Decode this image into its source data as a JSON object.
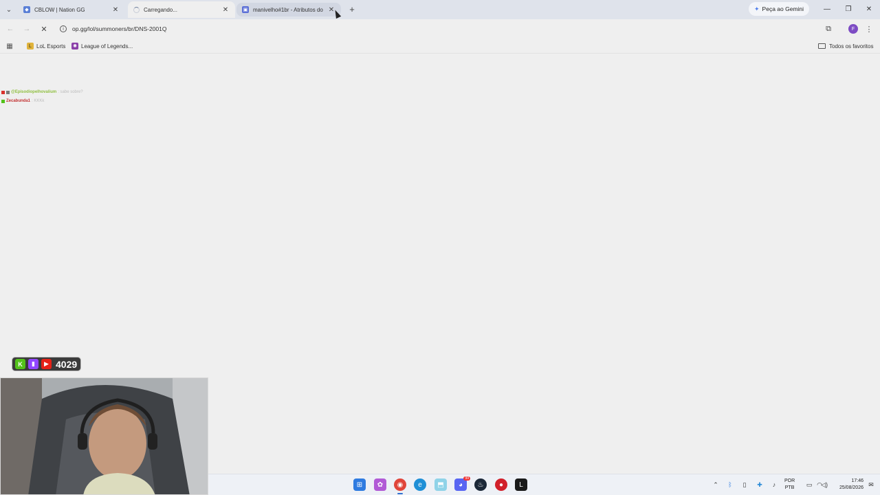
{
  "tabs": [
    {
      "title": "CBLOW | Nation GG",
      "state": "normal"
    },
    {
      "title": "Carregando...",
      "state": "loading-active"
    },
    {
      "title": "manivelho#1br - Atributos do",
      "state": "hover"
    }
  ],
  "tabstrip": {
    "gemini_label": "Peça ao Gemini"
  },
  "toolbar": {
    "url": "op.gg/lol/summoners/br/DNS-2001Q",
    "avatar_letter": "F"
  },
  "bookmarks": {
    "items": [
      {
        "label": "LoL Esports"
      },
      {
        "label": "League of Legends..."
      }
    ],
    "all_favorites": "Todos os favoritos"
  },
  "chat": [
    {
      "user": "@Episodiopelhovalium",
      "message": ": sabe sobre?",
      "color": "#8fbf3f"
    },
    {
      "user": "Zecabunda1",
      "message": ": KKKk",
      "color": "#c23030"
    }
  ],
  "overlay": {
    "viewer_count": "4029"
  },
  "taskbar": {
    "language_top": "POR",
    "language_bottom": "PTB",
    "time": "17:46",
    "date": "25/08/2026",
    "discord_badge": "99"
  },
  "colors": {
    "accent": "#3070d0",
    "avatar": "#7d4cc4",
    "tabstrip": "#dfe3eb",
    "page_bg": "#efefef"
  }
}
